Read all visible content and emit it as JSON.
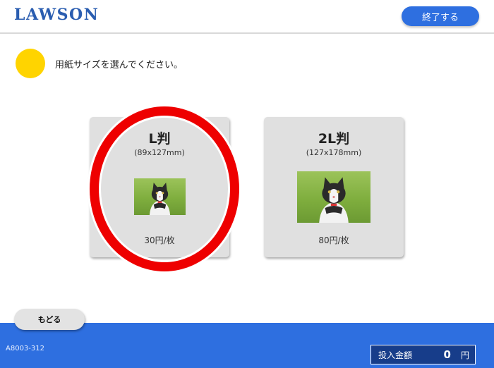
{
  "header": {
    "logo": "LAWSON",
    "end_button": "終了する"
  },
  "instruction": "用紙サイズを選んでください。",
  "options": [
    {
      "title": "L判",
      "size": "(89x127mm)",
      "price": "30円/枚",
      "photo_icon": "cat-photo",
      "selected": true
    },
    {
      "title": "2L判",
      "size": "(127x178mm)",
      "price": "80円/枚",
      "photo_icon": "cat-photo",
      "selected": false
    }
  ],
  "back_button": "もどる",
  "footer": {
    "code": "A8003-312",
    "inserted_label": "投入金額",
    "inserted_value": "0",
    "currency": "円"
  },
  "colors": {
    "accent_blue": "#2e6fe0",
    "indicator_yellow": "#ffd400",
    "highlight_red": "#ee0000",
    "card_gray": "#e0e0e0"
  }
}
